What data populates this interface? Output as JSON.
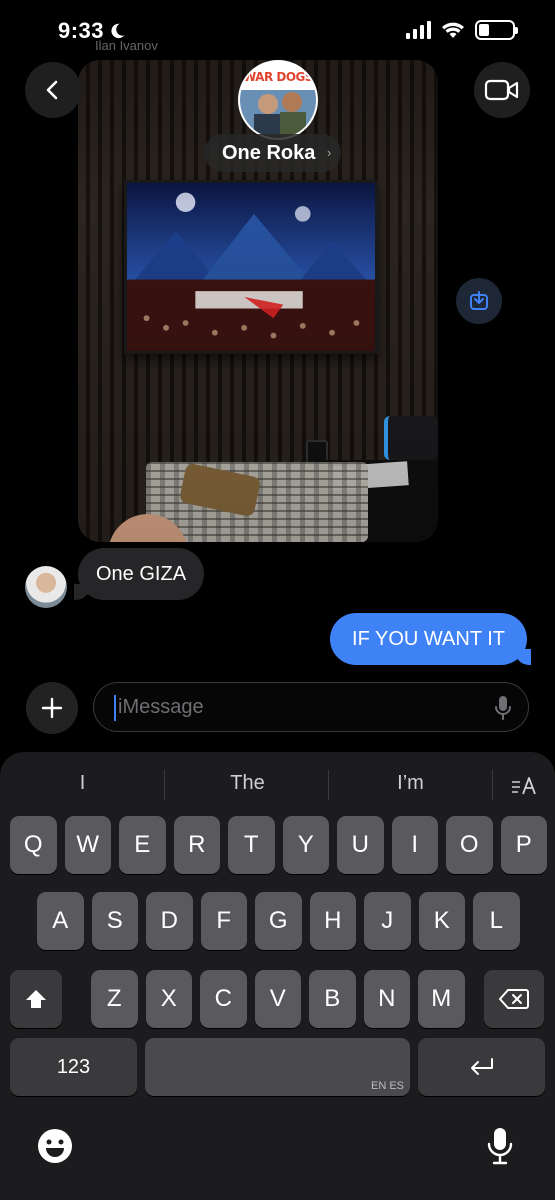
{
  "status_bar": {
    "time": "9:33",
    "focus_icon": "moon-icon"
  },
  "header": {
    "faded_sender": "Ilan Ivanov",
    "group_avatar_text": "WAR DOGS",
    "group_name": "One Roka",
    "group_chevron": "›"
  },
  "messages": [
    {
      "direction": "in",
      "text": "One GIZA"
    },
    {
      "direction": "out",
      "text": "IF YOU WANT IT"
    }
  ],
  "compose": {
    "placeholder": "iMessage"
  },
  "keyboard": {
    "suggestions": [
      "I",
      "The",
      "I’m"
    ],
    "rows": [
      [
        "Q",
        "W",
        "E",
        "R",
        "T",
        "Y",
        "U",
        "I",
        "O",
        "P"
      ],
      [
        "A",
        "S",
        "D",
        "F",
        "G",
        "H",
        "J",
        "K",
        "L"
      ],
      [
        "Z",
        "X",
        "C",
        "V",
        "B",
        "N",
        "M"
      ]
    ],
    "numbers_label": "123",
    "space_lang": "EN ES"
  },
  "colors": {
    "accent": "#3e82f6",
    "incoming": "#262628",
    "keyboard_bg": "#1c1c1e"
  }
}
